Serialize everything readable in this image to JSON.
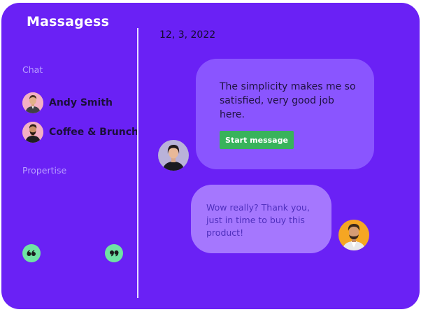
{
  "app": {
    "title": "Massagess"
  },
  "sidebar": {
    "chat_label": "Chat",
    "contacts": [
      {
        "name": "Andy Smith",
        "avatar_icon": "man-avatar"
      },
      {
        "name": "Coffee & Brunch",
        "avatar_icon": "man-beard-avatar"
      }
    ],
    "propertise_label": "Propertise",
    "quote_buttons": [
      {
        "icon": "quote-open-icon"
      },
      {
        "icon": "quote-close-icon"
      }
    ]
  },
  "conversation": {
    "date": "12, 3, 2022",
    "messages": [
      {
        "text": "The simplicity makes me so satisfied, very good job here.",
        "button_label": "Start message",
        "avatar_icon": "woman-avatar"
      },
      {
        "text": "Wow really? Thank you, just in time to buy this product!",
        "avatar_icon": "man-avatar"
      }
    ]
  },
  "colors": {
    "background": "#6a21f5",
    "bubble_primary": "#8a55ff",
    "bubble_secondary": "#a577fe",
    "accent_green": "#38b35b",
    "quote_button": "#6fe3a3"
  }
}
